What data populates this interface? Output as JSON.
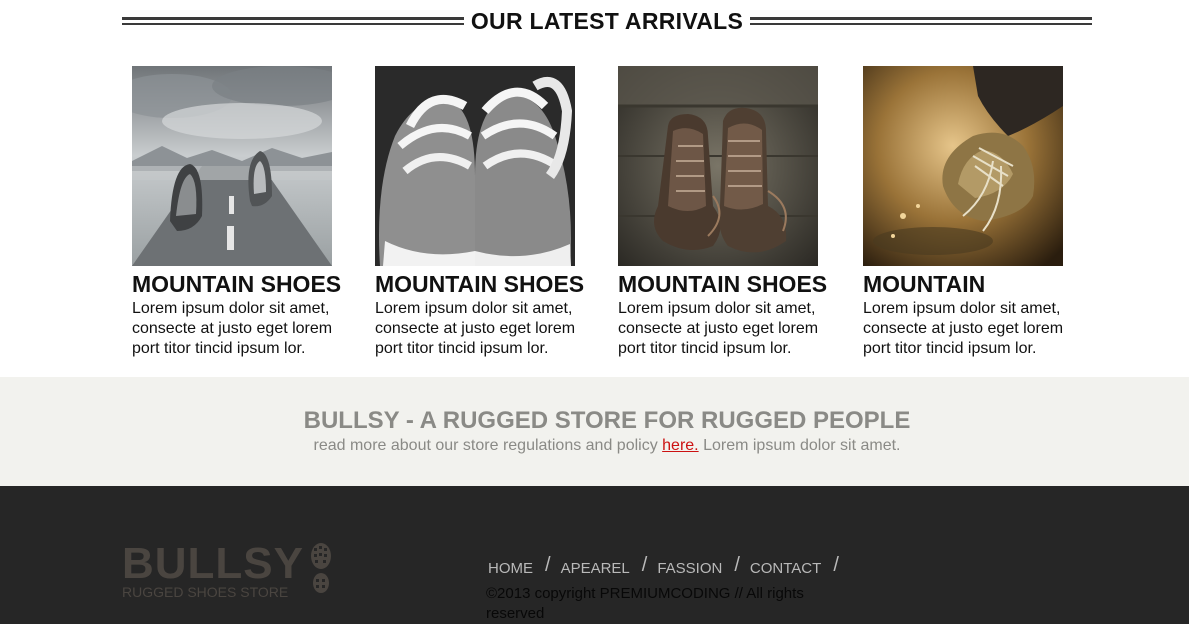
{
  "section": {
    "title": "OUR LATEST ARRIVALS"
  },
  "products": [
    {
      "name": "MOUNTAIN SHOES",
      "description": "Lorem ipsum dolor sit amet, consecte at justo eget lorem port titor tincid ipsum lor.",
      "image": "shoes-on-road"
    },
    {
      "name": "MOUNTAIN SHOES",
      "description": "Lorem ipsum dolor sit amet, consecte at justo eget lorem port titor tincid ipsum lor.",
      "image": "white-laced-sneakers"
    },
    {
      "name": "MOUNTAIN SHOES",
      "description": "Lorem ipsum dolor sit amet, consecte at justo eget lorem port titor tincid ipsum lor.",
      "image": "brown-leather-boots"
    },
    {
      "name": "MOUNTAIN",
      "description": "Lorem ipsum dolor sit amet, consecte at justo eget lorem port titor tincid ipsum lor.",
      "image": "shoe-in-puddle"
    }
  ],
  "banner": {
    "title": "BULLSY - A RUGGED STORE FOR RUGGED PEOPLE",
    "text_before": "read more about our store regulations and policy ",
    "link": "here.",
    "text_after": " Lorem ipsum dolor sit amet."
  },
  "footer": {
    "logo_word": "BULLSY",
    "logo_tagline": "RUGGED SHOES STORE",
    "logo_icon": "boot-print-icon",
    "nav": [
      "HOME",
      "APEAREL",
      "FASSION",
      "CONTACT"
    ],
    "nav_separator": "/",
    "copyright": "©2013 copyright PREMIUMCODING // All rights reserved"
  },
  "colors": {
    "banner_bg": "#f2f2ee",
    "banner_text": "#8a8a86",
    "link": "#cc1111",
    "footer_bg": "#262626",
    "logo": "#4a4540",
    "nav_text": "#b9b9b9"
  }
}
